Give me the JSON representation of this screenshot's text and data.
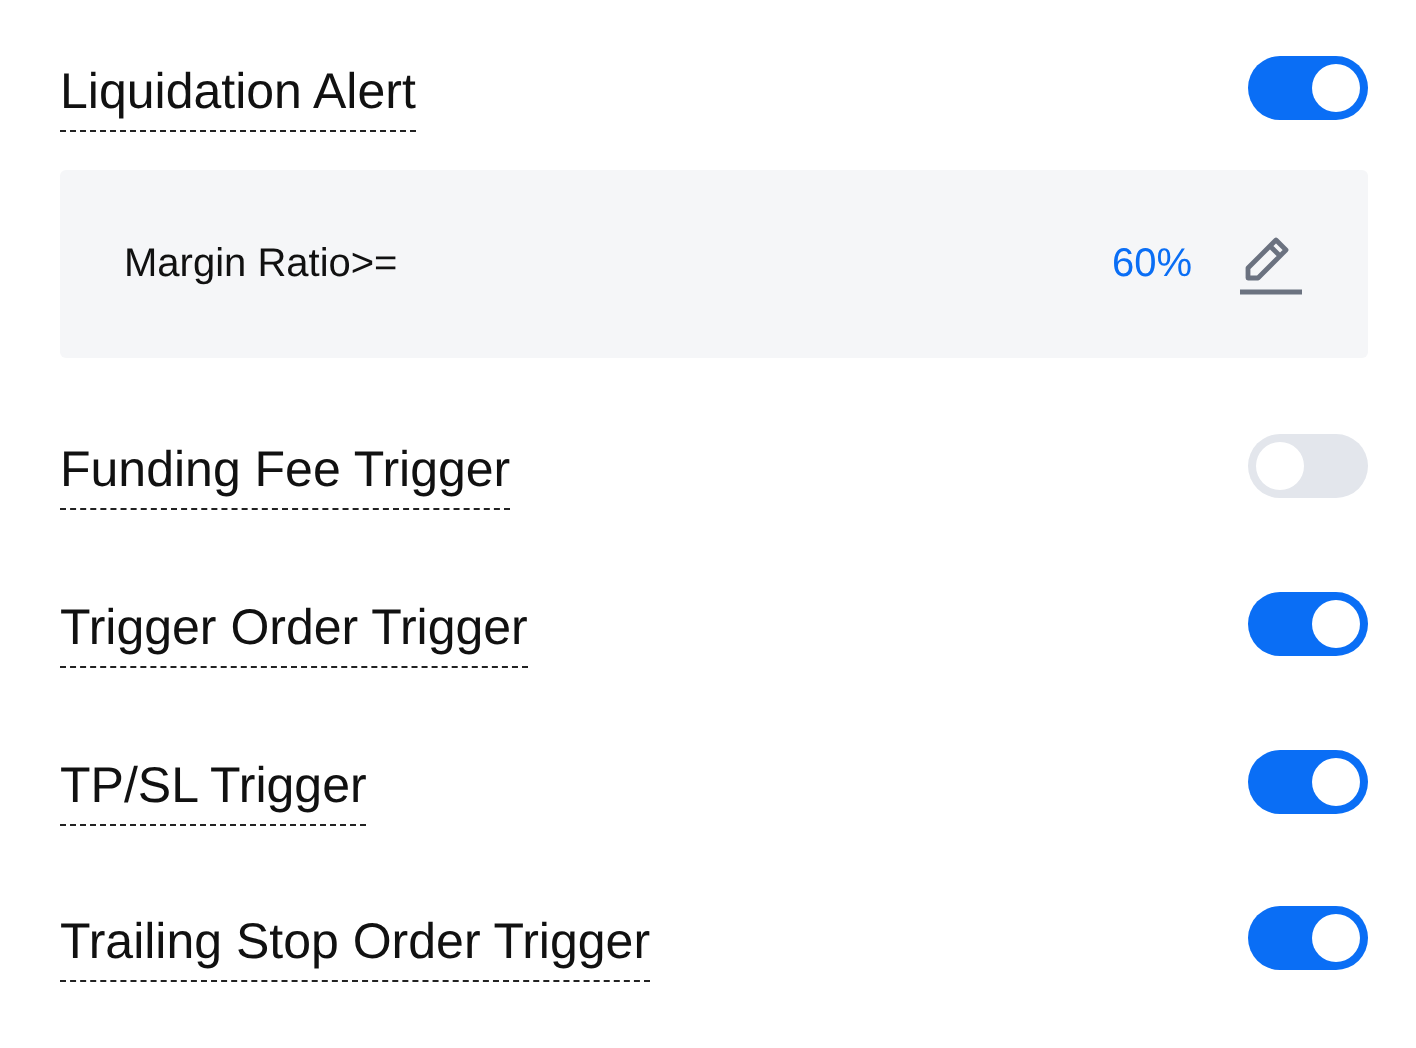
{
  "alerts": [
    {
      "label": "Liquidation Alert",
      "on": true,
      "setting": {
        "label": "Margin Ratio>=",
        "value": "60%"
      }
    },
    {
      "label": "Funding Fee Trigger",
      "on": false
    },
    {
      "label": "Trigger Order Trigger",
      "on": true
    },
    {
      "label": "TP/SL Trigger",
      "on": true
    },
    {
      "label": "Trailing Stop Order Trigger",
      "on": true
    }
  ]
}
